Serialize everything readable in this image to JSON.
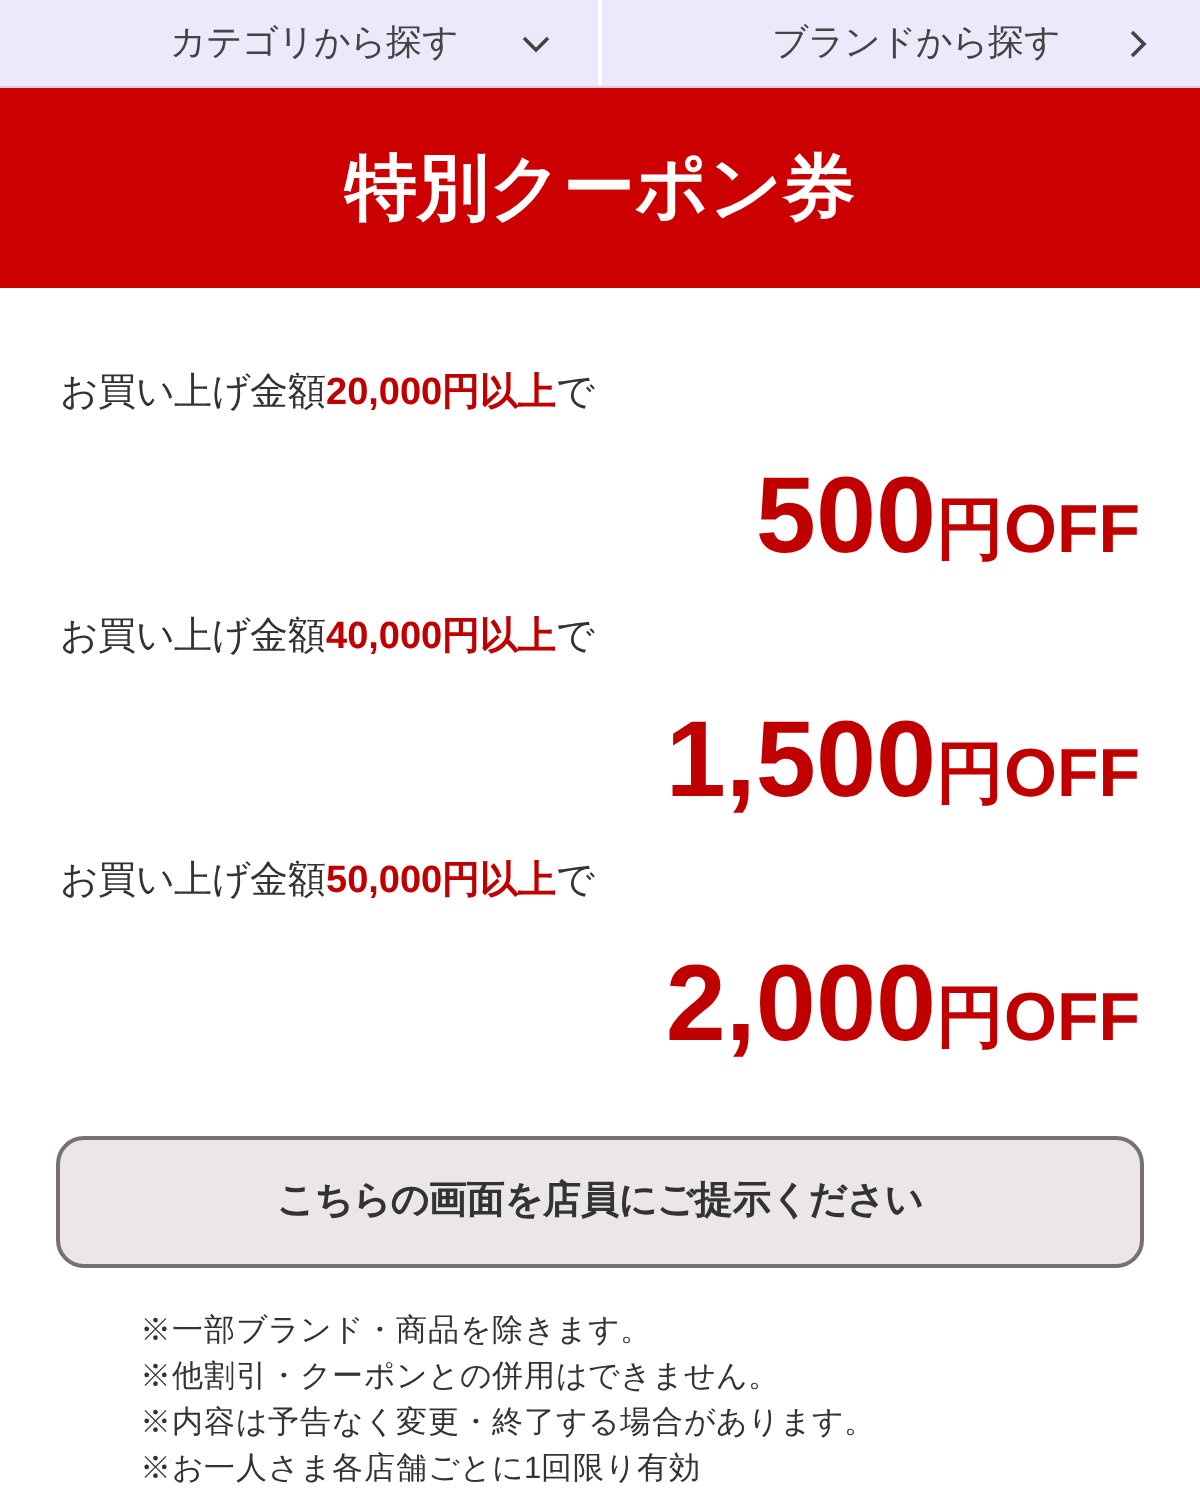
{
  "nav": [
    {
      "label": "カテゴリから探す",
      "kind": "dropdown"
    },
    {
      "label": "ブランドから探す",
      "kind": "link"
    }
  ],
  "banner": {
    "title": "特別クーポン券"
  },
  "offers": [
    {
      "condition": "お買い上げ金額**20,000円以上**で",
      "amount": "500",
      "unit": "円",
      "suffix": "OFF"
    },
    {
      "condition": "お買い上げ金額**40,000円以上**で",
      "amount": "1,500",
      "unit": "円",
      "suffix": "OFF"
    },
    {
      "condition": "お買い上げ金額**50,000円以上**で",
      "amount": "2,000",
      "unit": "円",
      "suffix": "OFF"
    }
  ],
  "notice_button": {
    "label": "こちらの画面を店員にご提示ください"
  },
  "notes": [
    "※一部ブランド・商品を除きます。",
    "※他割引・クーポンとの併用はできません。",
    "※内容は予告なく変更・終了する場合があります。",
    "※お一人さま各店舗ごとに1回限り有効"
  ]
}
